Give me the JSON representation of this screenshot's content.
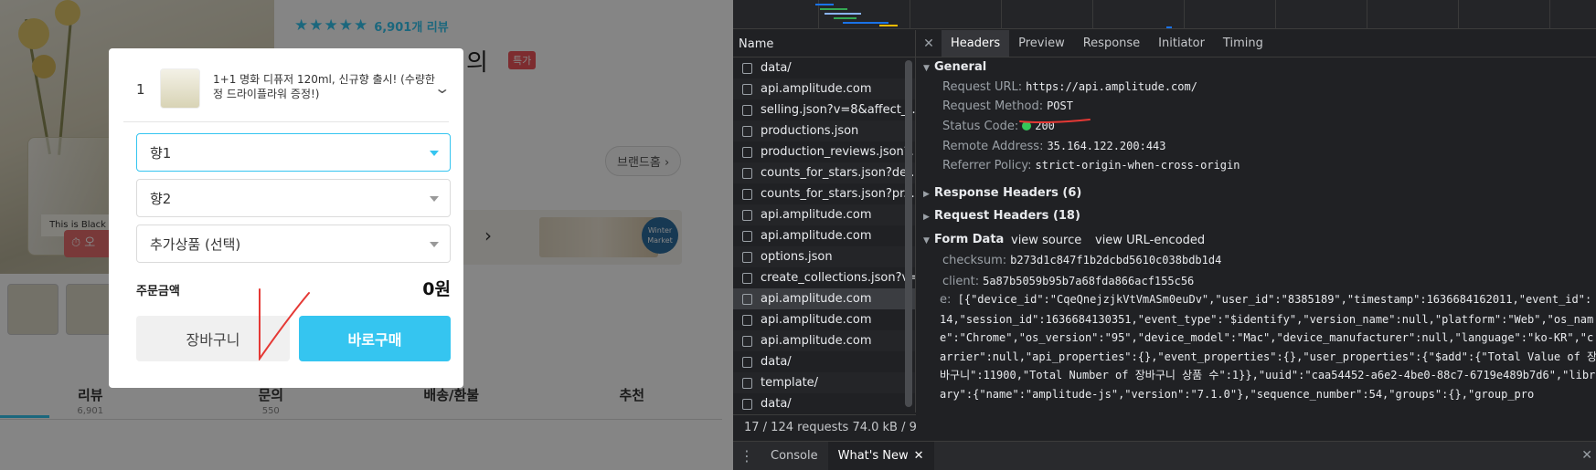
{
  "shop": {
    "rating_count": "6,901개 리뷰",
    "title_tail": "의",
    "special_badge": "특가",
    "brand_home": "브랜드홈 ›",
    "timer_badge": "오",
    "photo_label": "This is Black",
    "banner_badge": "Winter Market",
    "tabs": [
      {
        "label": "리뷰",
        "sub": "6,901"
      },
      {
        "label": "문의",
        "sub": "550"
      },
      {
        "label": "배송/환불",
        "sub": ""
      },
      {
        "label": "추천",
        "sub": ""
      }
    ]
  },
  "modal": {
    "option_index": "1",
    "option_title": "1+1 명화 디퓨저 120ml, 신규향 출시! (수량한정 드라이플라워 증정!)",
    "select_1": "향1",
    "select_2": "향2",
    "select_3": "추가상품 (선택)",
    "total_label": "주문금액",
    "total_value": "0원",
    "cart_button": "장바구니",
    "buy_button": "바로구매"
  },
  "devtools": {
    "name_header": "Name",
    "requests": [
      "data/",
      "api.amplitude.com",
      "selling.json?v=8&affect_t...",
      "productions.json",
      "production_reviews.json?...",
      "counts_for_stars.json?de...",
      "counts_for_stars.json?pr...",
      "api.amplitude.com",
      "api.amplitude.com",
      "options.json",
      "create_collections.json?v=...",
      "api.amplitude.com",
      "api.amplitude.com",
      "api.amplitude.com",
      "data/",
      "template/",
      "data/"
    ],
    "selected_index": 11,
    "summary": "17 / 124 requests   74.0 kB / 9",
    "tabs": [
      "Headers",
      "Preview",
      "Response",
      "Initiator",
      "Timing"
    ],
    "active_tab": "Headers",
    "general_title": "General",
    "general": [
      {
        "k": "Request URL:",
        "v": "https://api.amplitude.com/"
      },
      {
        "k": "Request Method:",
        "v": "POST"
      },
      {
        "k": "Status Code:",
        "v": "200"
      },
      {
        "k": "Remote Address:",
        "v": "35.164.122.200:443"
      },
      {
        "k": "Referrer Policy:",
        "v": "strict-origin-when-cross-origin"
      }
    ],
    "response_headers": "Response Headers (6)",
    "request_headers": "Request Headers (18)",
    "form_data": "Form Data",
    "view_source": "view source",
    "view_url_encoded": "view URL-encoded",
    "checksum_k": "checksum:",
    "checksum_v": "b273d1c847f1b2dcbd5610c038bdb1d4",
    "client_k": "client:",
    "client_v": "5a87b5059b95b7a68fda866acf155c56",
    "e_k": "e:",
    "e_v": "[{\"device_id\":\"CqeQnejzjkVtVmASm0euDv\",\"user_id\":\"8385189\",\"timestamp\":1636684162011,\"event_id\":14,\"session_id\":1636684130351,\"event_type\":\"$identify\",\"version_name\":null,\"platform\":\"Web\",\"os_name\":\"Chrome\",\"os_version\":\"95\",\"device_model\":\"Mac\",\"device_manufacturer\":null,\"language\":\"ko-KR\",\"carrier\":null,\"api_properties\":{},\"event_properties\":{},\"user_properties\":{\"$add\":{\"Total Value of 장바구니\":11900,\"Total Number of 장바구니 상품 수\":1}},\"uuid\":\"caa54452-a6e2-4be0-88c7-6719e489b7d6\",\"library\":{\"name\":\"amplitude-js\",\"version\":\"7.1.0\"},\"sequence_number\":54,\"groups\":{},\"group_pro",
    "drawer_tabs": [
      "Console",
      "What's New"
    ],
    "active_drawer_tab": "What's New"
  },
  "colors": {
    "accent": "#35c5f0",
    "devtools_bg": "#202124",
    "annotation_red": "#e53935"
  }
}
